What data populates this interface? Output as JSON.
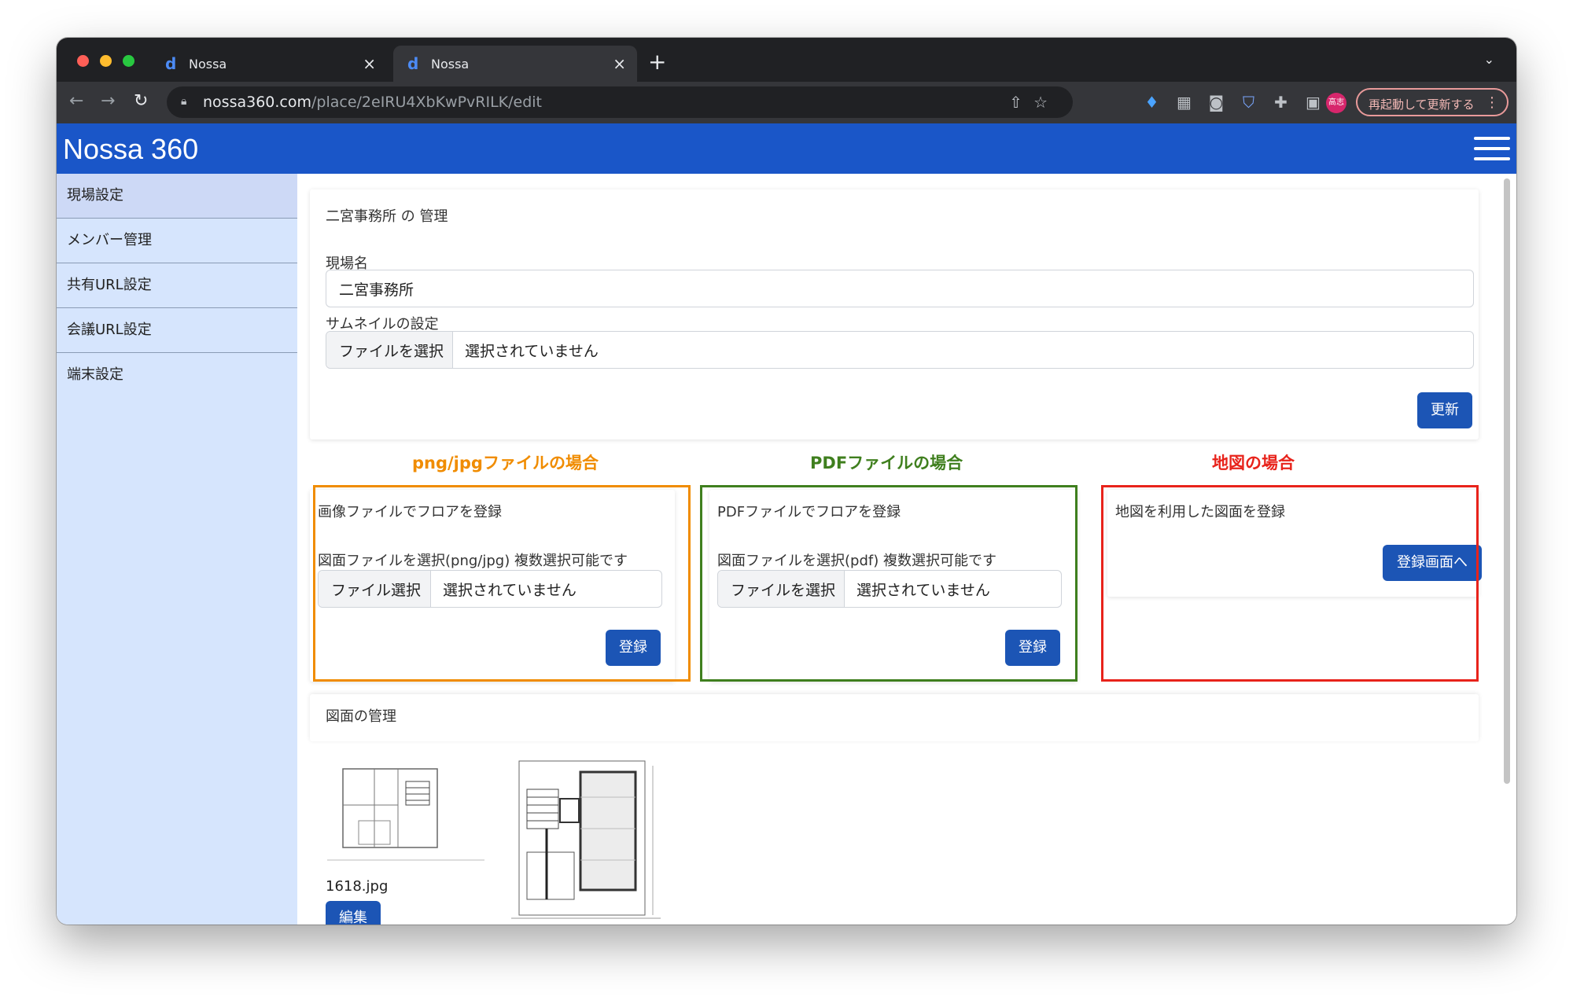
{
  "browser": {
    "tabs": [
      {
        "title": "Nossa"
      },
      {
        "title": "Nossa"
      }
    ],
    "url_host": "nossa360.com",
    "url_path": "/place/2eIRU4XbKwPvRILK/edit",
    "profile_initials": "高志",
    "relaunch_label": "再起動して更新する"
  },
  "app": {
    "brand": "Nossa 360"
  },
  "sidebar": {
    "items": [
      {
        "label": "現場設定"
      },
      {
        "label": "メンバー管理"
      },
      {
        "label": "共有URL設定"
      },
      {
        "label": "会議URL設定"
      },
      {
        "label": "端末設定"
      }
    ]
  },
  "site_card": {
    "title": "二宮事務所 の 管理",
    "name_label": "現場名",
    "name_value": "二宮事務所",
    "thumb_label": "サムネイルの設定",
    "thumb_file_button": "ファイルを選択",
    "thumb_file_status": "選択されていません",
    "update_button": "更新"
  },
  "annotations": {
    "image": "png/jpgファイルの場合",
    "pdf": "PDFファイルの場合",
    "map": "地図の場合"
  },
  "image_card": {
    "title": "画像ファイルでフロアを登録",
    "hint": "図面ファイルを選択(png/jpg) 複数選択可能です",
    "file_button": "ファイル選択",
    "file_status": "選択されていません",
    "register_button": "登録"
  },
  "pdf_card": {
    "title": "PDFファイルでフロアを登録",
    "hint": "図面ファイルを選択(pdf) 複数選択可能です",
    "file_button": "ファイルを選択",
    "file_status": "選択されていません",
    "register_button": "登録"
  },
  "map_card": {
    "title": "地図を利用した図面を登録",
    "register_button": "登録画面へ"
  },
  "drawings": {
    "title": "図面の管理",
    "items": [
      {
        "filename": "1618.jpg",
        "edit_button": "編集"
      }
    ]
  },
  "colors": {
    "primary": "#1a56c8",
    "button": "#1c55b5",
    "sidebar": "#d6e5fd",
    "annot_image": "#f08c00",
    "annot_pdf": "#3f7f1e",
    "annot_map": "#e8231b"
  }
}
